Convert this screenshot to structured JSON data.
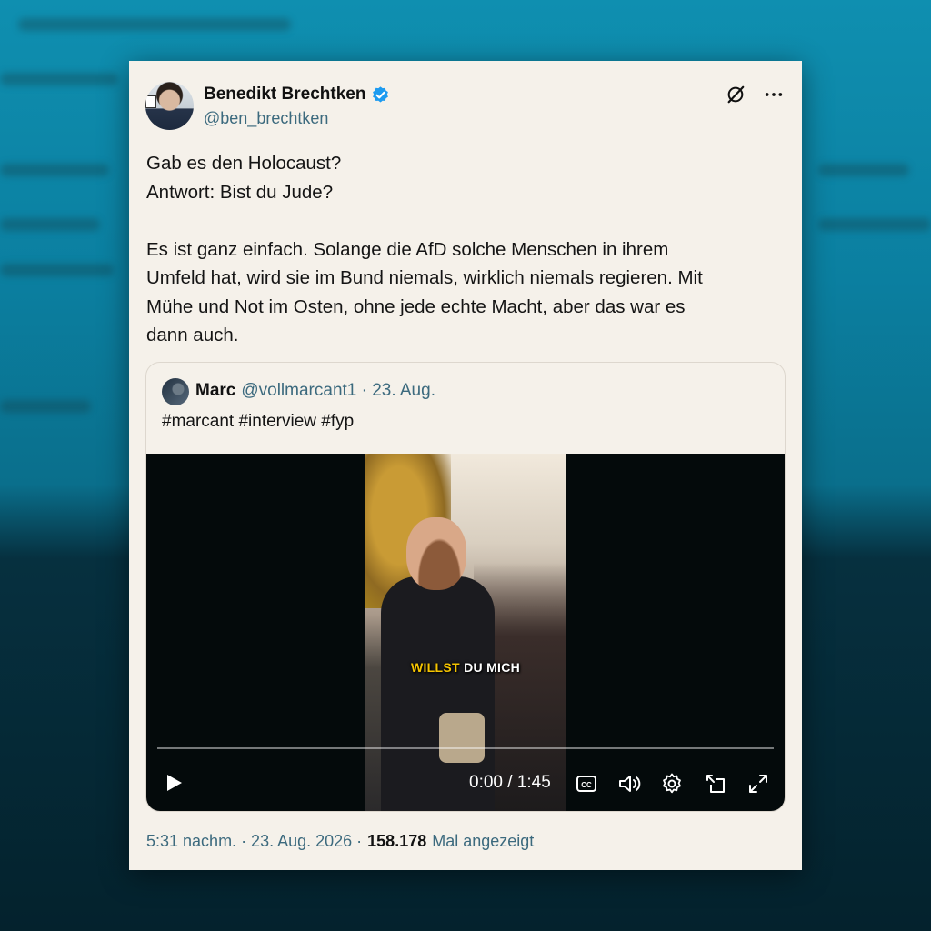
{
  "tweet": {
    "author_name": "Benedikt Brechtken",
    "author_handle": "@ben_brechtken",
    "lines": [
      "Gab es den Holocaust?",
      "Antwort: Bist du Jude?",
      "Es ist ganz einfach. Solange die AfD solche Menschen in ihrem",
      "Umfeld hat, wird sie im Bund niemals, wirklich niemals regieren. Mit",
      "Mühe und Not im Osten, ohne jede echte Macht, aber das war es",
      "dann auch."
    ],
    "timestamp": "5:31 nachm. · 23. Aug. 2026 ·",
    "views_count": "158.178",
    "views_label": "Mal angezeigt"
  },
  "quote": {
    "author_name": "Marc",
    "meta": "@vollmarcant1 · 23. Aug.",
    "text": "#marcant #interview #fyp",
    "video": {
      "caption_highlight": "WILLST",
      "caption_rest": "DU MICH",
      "time": "0:00 / 1:45",
      "progress": 0
    }
  },
  "icons": {
    "verified": "verified-badge-icon",
    "grok": "grok-icon",
    "more": "more-icon",
    "play": "play-icon",
    "captions": "captions-icon",
    "volume": "volume-icon",
    "settings": "settings-icon",
    "pip": "picture-in-picture-icon",
    "fullscreen": "fullscreen-icon"
  },
  "colors": {
    "accent": "#1d9bf0",
    "card_bg": "#f5f1ea",
    "caption_highlight": "#f5c400"
  }
}
